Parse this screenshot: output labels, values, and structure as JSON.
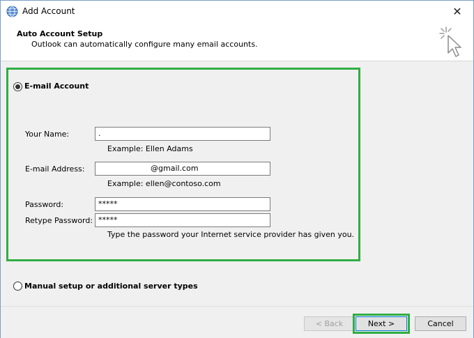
{
  "window": {
    "title": "Add Account"
  },
  "header": {
    "title": "Auto Account Setup",
    "subtitle": "Outlook can automatically configure many email accounts."
  },
  "email_account": {
    "label": "E-mail Account",
    "checked": true,
    "your_name": {
      "label": "Your Name:",
      "value": ".",
      "hint": "Example: Ellen Adams"
    },
    "email_address": {
      "label": "E-mail Address:",
      "value": "@gmail.com",
      "hint": "Example: ellen@contoso.com"
    },
    "password": {
      "label": "Password:",
      "value": "*****"
    },
    "retype_password": {
      "label": "Retype Password:",
      "value": "*****"
    },
    "password_hint": "Type the password your Internet service provider has given you."
  },
  "manual_setup": {
    "label": "Manual setup or additional server types",
    "checked": false
  },
  "buttons": {
    "back": "< Back",
    "next": "Next >",
    "cancel": "Cancel"
  },
  "colors": {
    "highlight": "#2fae43",
    "accent": "#0078d7"
  },
  "icons": {
    "app": "outlook-globe-icon",
    "close": "close-icon",
    "wizard": "cursor-wand-icon"
  }
}
